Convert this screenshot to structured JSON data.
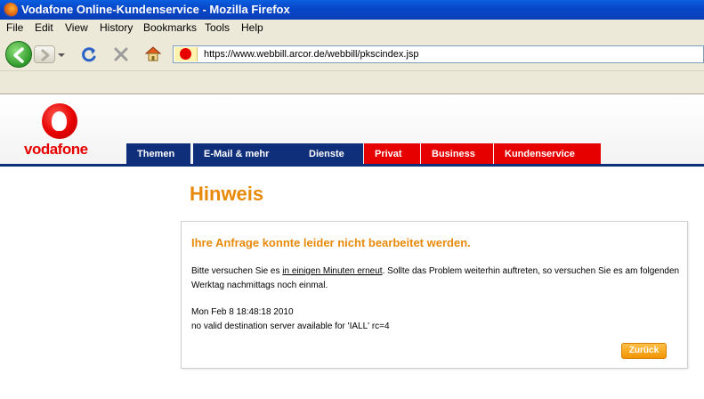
{
  "window": {
    "title": "Vodafone Online-Kundenservice - Mozilla Firefox"
  },
  "menu": [
    "File",
    "Edit",
    "View",
    "History",
    "Bookmarks",
    "Tools",
    "Help"
  ],
  "address_bar": {
    "url": "https://www.webbill.arcor.de/webbill/pkscindex.jsp"
  },
  "brand": {
    "name": "vodafone",
    "color": "#e60000"
  },
  "tabs": [
    {
      "label": "Themen",
      "color": "#0f2f7a"
    },
    {
      "label": "E-Mail & mehr",
      "color": "#0f2f7a"
    },
    {
      "label": "Dienste",
      "color": "#0f2f7a"
    },
    {
      "label": "Privat",
      "color": "#e60000"
    },
    {
      "label": "Business",
      "color": "#e60000"
    },
    {
      "label": "Kundenservice",
      "color": "#e60000"
    }
  ],
  "content": {
    "heading": "Hinweis",
    "message_title": "Ihre Anfrage konnte leider nicht bearbeitet werden.",
    "body_before_link": "Bitte versuchen Sie es ",
    "body_link": "in einigen Minuten erneut",
    "body_after_link": ". Sollte das Problem weiterhin auftreten, so versuchen Sie es am folgenden Werktag nachmittags noch einmal.",
    "timestamp": "Mon Feb 8 18:48:18 2010",
    "error": "no valid destination server available for 'IALL' rc=4",
    "back_button": "Zurück"
  },
  "colors": {
    "accent_orange": "#e8890a"
  }
}
